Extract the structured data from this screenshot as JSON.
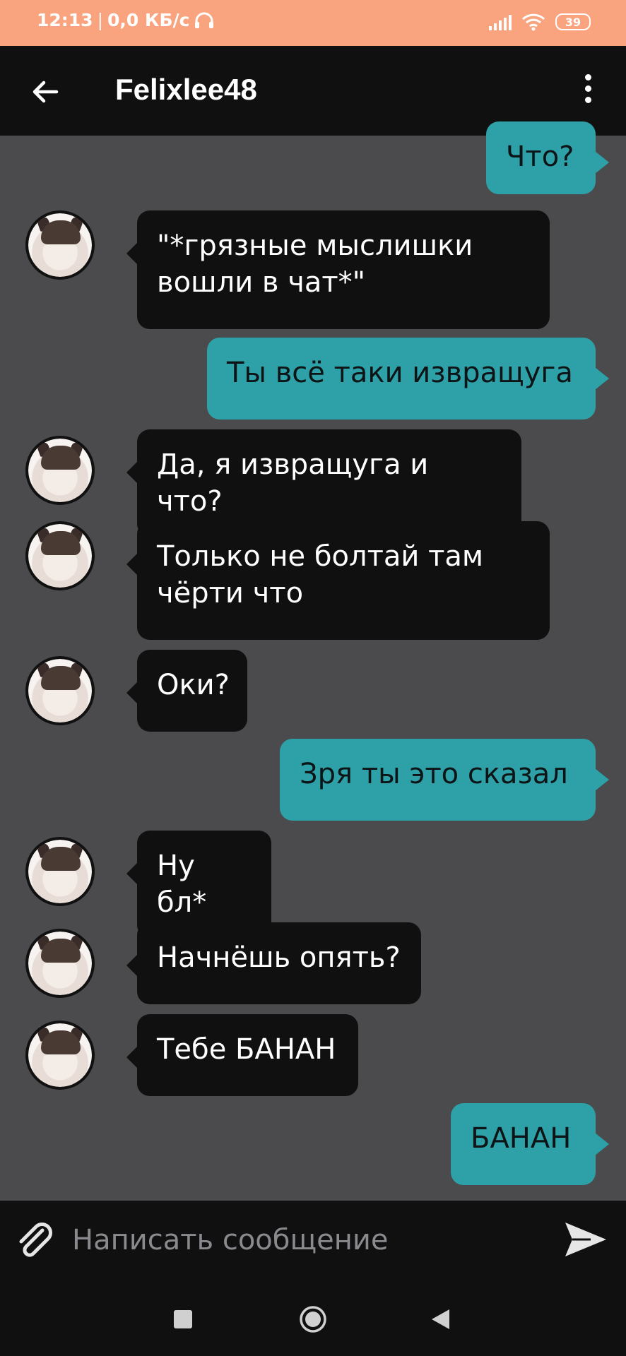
{
  "status_bar": {
    "time": "12:13",
    "speed": "0,0 КБ/с",
    "battery": "39"
  },
  "header": {
    "title": "Felixlee48"
  },
  "messages": [
    {
      "side": "out",
      "text": "Что?"
    },
    {
      "side": "in",
      "text": "\"*грязные мыслишки вошли в чат*\""
    },
    {
      "side": "out",
      "text": "Ты всё таки извращуга"
    },
    {
      "side": "in",
      "text": "Да, я извращуга и что?"
    },
    {
      "side": "in",
      "text": "Только не болтай там чёрти что"
    },
    {
      "side": "in",
      "text": "Оки?"
    },
    {
      "side": "out",
      "text": "Зря ты это сказал"
    },
    {
      "side": "in",
      "text": "Ну бл*"
    },
    {
      "side": "in",
      "text": "Начнёшь опять?"
    },
    {
      "side": "in",
      "text": "Тебе БАНАН"
    },
    {
      "side": "out",
      "text": "БАНАН"
    }
  ],
  "composer": {
    "placeholder": "Написать сообщение"
  },
  "colors": {
    "status_bar": "#f9a47f",
    "chat_bg": "#4b4a4d",
    "incoming_bubble": "#101011",
    "outgoing_bubble": "#2ea0a8"
  },
  "icons": {
    "back": "arrow-left-icon",
    "more": "more-vertical-icon",
    "attach": "paperclip-icon",
    "send": "send-icon",
    "headphones": "headphones-icon",
    "signal": "signal-icon",
    "wifi": "wifi-icon",
    "battery": "battery-icon",
    "nav_recents": "square-icon",
    "nav_home": "circle-icon",
    "nav_back": "triangle-back-icon"
  }
}
